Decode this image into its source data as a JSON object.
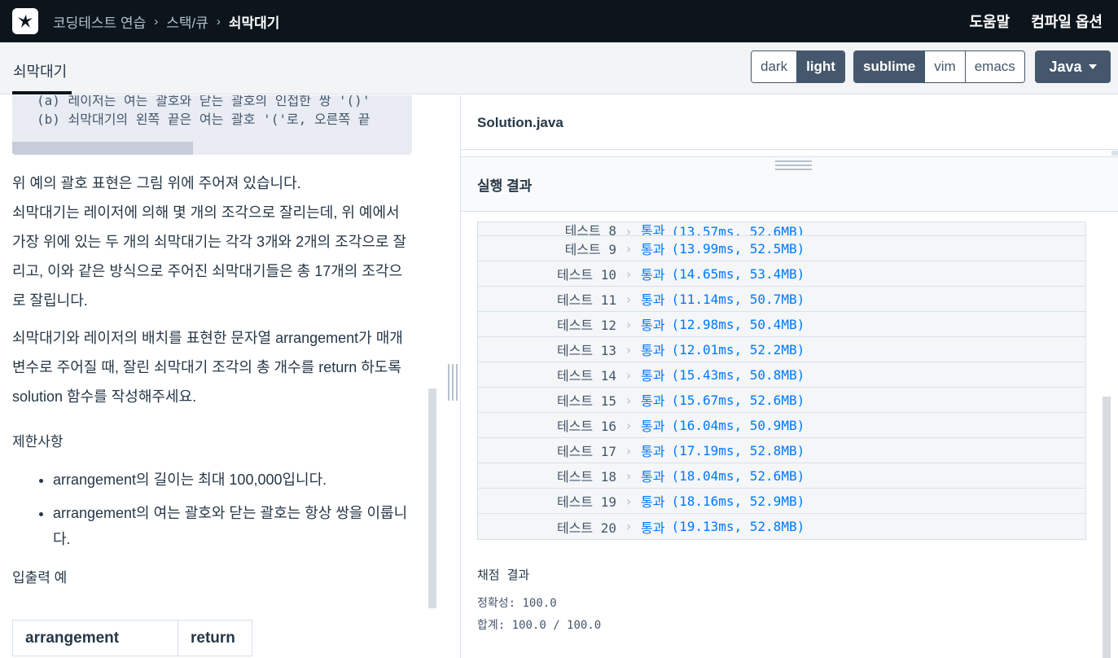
{
  "nav": {
    "breadcrumbs": [
      "코딩테스트 연습",
      "스택/큐",
      "쇠막대기"
    ],
    "right_links": [
      "도움말",
      "컴파일 옵션"
    ]
  },
  "subheader": {
    "title": "쇠막대기",
    "themes": [
      {
        "label": "dark",
        "active": false
      },
      {
        "label": "light",
        "active": true
      }
    ],
    "editors": [
      {
        "label": "sublime",
        "active": true
      },
      {
        "label": "vim",
        "active": false
      },
      {
        "label": "emacs",
        "active": false
      }
    ],
    "language": "Java"
  },
  "problem": {
    "code_lines": [
      "(a) 레이저는 여는 괄호와 닫는 괄호의 인접한 쌍 '()'",
      "(b) 쇠막대기의 왼쪽 끝은 여는 괄호 '('로, 오른쪽 끝"
    ],
    "paragraph1_line1": "위 예의 괄호 표현은 그림 위에 주어져 있습니다.",
    "paragraph1_rest": "쇠막대기는 레이저에 의해 몇 개의 조각으로 잘리는데, 위 예에서 가장 위에 있는 두 개의 쇠막대기는 각각 3개와 2개의 조각으로 잘리고, 이와 같은 방식으로 주어진 쇠막대기들은 총 17개의 조각으로 잘립니다.",
    "paragraph2": "쇠막대기와 레이저의 배치를 표현한 문자열 arrangement가 매개변수로 주어질 때, 잘린 쇠막대기 조각의 총 개수를 return 하도록 solution 함수를 작성해주세요.",
    "constraints_title": "제한사항",
    "constraints": [
      "arrangement의 길이는 최대 100,000입니다.",
      "arrangement의 여는 괄호와 닫는 괄호는 항상 쌍을 이룹니다."
    ],
    "io_title": "입출력 예",
    "io_headers": [
      "arrangement",
      "return"
    ]
  },
  "editor": {
    "filename": "Solution.java"
  },
  "results": {
    "title": "실행 결과",
    "tests": [
      {
        "name": "테스트 8",
        "status": "통과",
        "detail": "(13.57ms, 52.6MB)"
      },
      {
        "name": "테스트 9",
        "status": "통과",
        "detail": "(13.99ms, 52.5MB)"
      },
      {
        "name": "테스트 10",
        "status": "통과",
        "detail": "(14.65ms, 53.4MB)"
      },
      {
        "name": "테스트 11",
        "status": "통과",
        "detail": "(11.14ms, 50.7MB)"
      },
      {
        "name": "테스트 12",
        "status": "통과",
        "detail": "(12.98ms, 50.4MB)"
      },
      {
        "name": "테스트 13",
        "status": "통과",
        "detail": "(12.01ms, 52.2MB)"
      },
      {
        "name": "테스트 14",
        "status": "통과",
        "detail": "(15.43ms, 50.8MB)"
      },
      {
        "name": "테스트 15",
        "status": "통과",
        "detail": "(15.67ms, 52.6MB)"
      },
      {
        "name": "테스트 16",
        "status": "통과",
        "detail": "(16.04ms, 50.9MB)"
      },
      {
        "name": "테스트 17",
        "status": "통과",
        "detail": "(17.19ms, 52.8MB)"
      },
      {
        "name": "테스트 18",
        "status": "통과",
        "detail": "(18.04ms, 52.6MB)"
      },
      {
        "name": "테스트 19",
        "status": "통과",
        "detail": "(18.16ms, 52.9MB)"
      },
      {
        "name": "테스트 20",
        "status": "통과",
        "detail": "(19.13ms, 52.8MB)"
      }
    ],
    "score_title": "채점 결과",
    "accuracy": "정확성: 100.0",
    "total": "합계: 100.0 / 100.0"
  },
  "colors": {
    "nav_bg": "#0c151c",
    "pass_blue": "#0078ff",
    "button_dark": "#44576c"
  }
}
